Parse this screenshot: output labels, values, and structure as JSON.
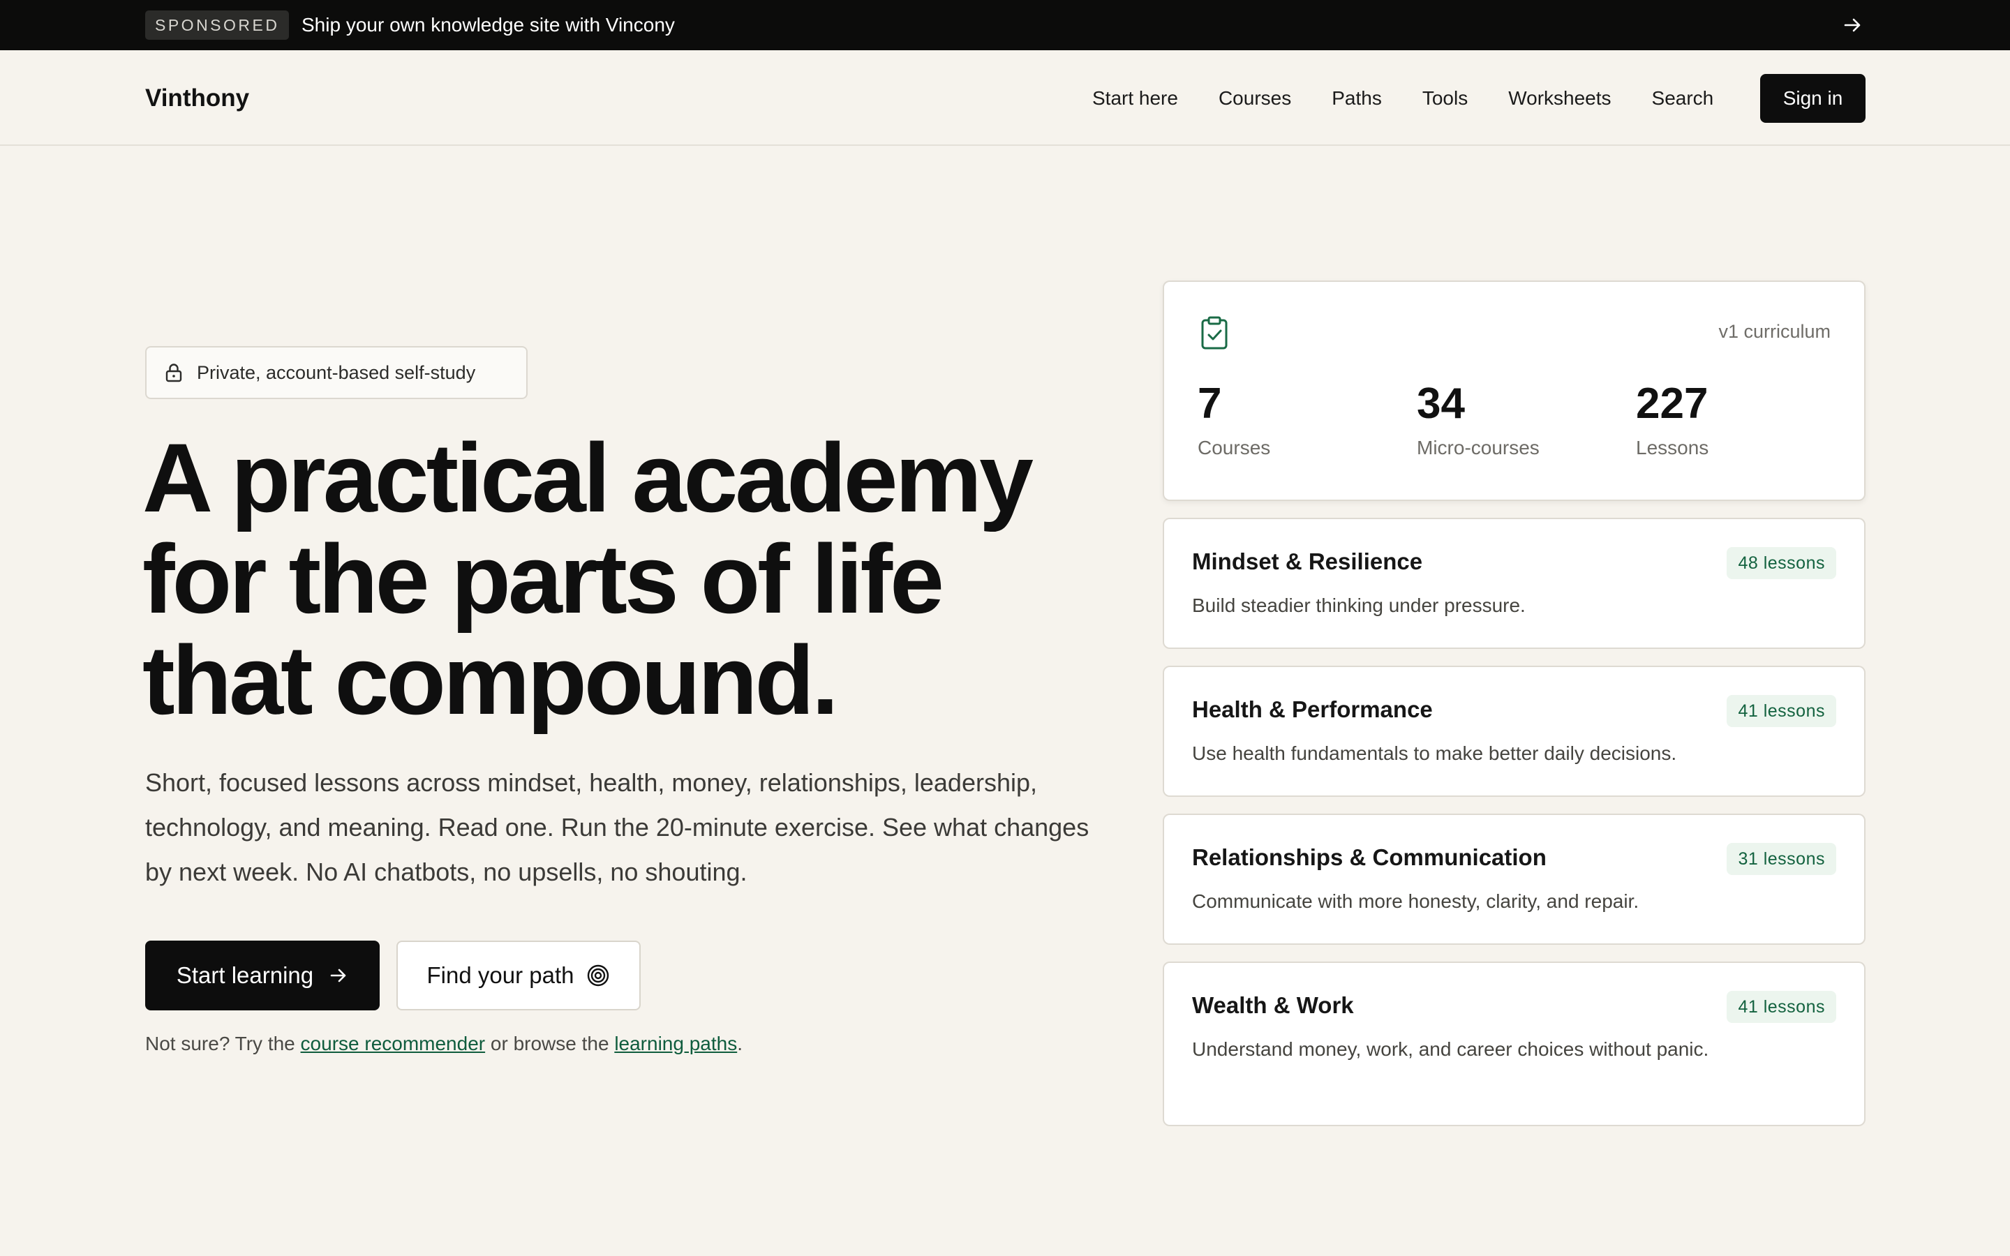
{
  "sponsor": {
    "badge": "SPONSORED",
    "text": "Ship your own knowledge site with Vincony",
    "arrow_icon": "arrow-right-icon"
  },
  "nav": {
    "logo": "Vinthony",
    "links": [
      "Start here",
      "Courses",
      "Paths",
      "Tools",
      "Worksheets",
      "Search"
    ],
    "signin": "Sign in"
  },
  "hero": {
    "badge": "Private, account-based self-study",
    "title_lines": [
      "A practical academy",
      "for the parts of life",
      "that compound."
    ],
    "description": "Short, focused lessons across mindset, health, money, relationships, leadership, technology, and meaning. Read one. Run the 20-minute exercise. See what changes by next week. No AI chatbots, no upsells, no shouting.",
    "primary_button": "Start learning",
    "secondary_button": "Find your path",
    "hint_prefix": "Not sure? Try the",
    "hint_link1": "course recommender",
    "hint_middle": "or browse the",
    "hint_link2": "learning paths",
    "hint_suffix": "."
  },
  "stats": {
    "curriculum_label": "v1 curriculum",
    "items": [
      {
        "value": "7",
        "label": "Courses"
      },
      {
        "value": "34",
        "label": "Micro-courses"
      },
      {
        "value": "227",
        "label": "Lessons"
      }
    ]
  },
  "courses": [
    {
      "title": "Mindset & Resilience",
      "desc": "Build steadier thinking under pressure.",
      "lessons": "48 lessons"
    },
    {
      "title": "Health & Performance",
      "desc": "Use health fundamentals to make better daily decisions.",
      "lessons": "41 lessons"
    },
    {
      "title": "Relationships & Communication",
      "desc": "Communicate with more honesty, clarity, and repair.",
      "lessons": "31 lessons"
    },
    {
      "title": "Wealth & Work",
      "desc": "Understand money, work, and career choices without panic.",
      "lessons": "41 lessons"
    }
  ],
  "colors": {
    "background": "#f6f3ed",
    "accent_green": "#13623f",
    "dark": "#0d0d0d"
  }
}
